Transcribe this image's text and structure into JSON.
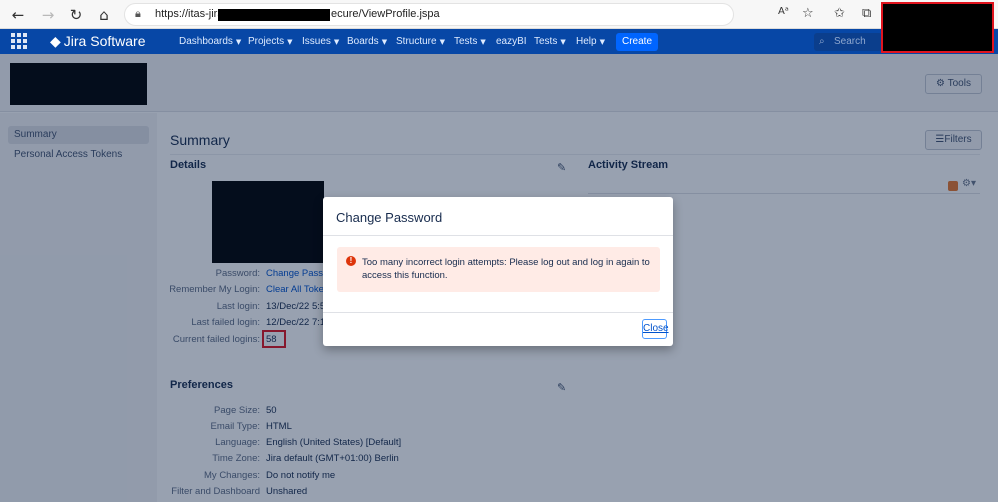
{
  "browser": {
    "url_prefix": "https://itas-jira",
    "url_suffix": "ecure/ViewProfile.jspa",
    "back_icon": "arrow-left-icon",
    "forward_icon": "arrow-right-icon",
    "reload_icon": "reload-icon",
    "home_icon": "home-icon"
  },
  "nav": {
    "product": "Jira Software",
    "menu": [
      {
        "label": "Dashboards",
        "caret": true
      },
      {
        "label": "Projects",
        "caret": true
      },
      {
        "label": "Issues",
        "caret": true
      },
      {
        "label": "Boards",
        "caret": true
      },
      {
        "label": "Structure",
        "caret": true
      },
      {
        "label": "Tests",
        "caret": true
      },
      {
        "label": "eazyBI",
        "caret": false
      },
      {
        "label": "Tests",
        "caret": true
      },
      {
        "label": "Help",
        "caret": true
      }
    ],
    "create_label": "Create",
    "search_placeholder": "Search"
  },
  "header": {
    "tools_label": "Tools"
  },
  "sidebar": {
    "items": [
      {
        "label": "Summary",
        "active": true
      },
      {
        "label": "Personal Access Tokens",
        "active": false
      }
    ]
  },
  "main": {
    "title": "Summary",
    "filters_label": "Filters",
    "details_heading": "Details",
    "activity_heading": "Activity Stream",
    "details": [
      {
        "label": "Password:",
        "value": "Change Passw",
        "link": true
      },
      {
        "label": "Remember My Login:",
        "value": "Clear All Token",
        "link": true
      },
      {
        "label": "Last login:",
        "value": "13/Dec/22 5:5",
        "link": false
      },
      {
        "label": "Last failed login:",
        "value": "12/Dec/22 7:1",
        "link": false
      },
      {
        "label": "Current failed logins:",
        "value": "58",
        "link": false
      }
    ],
    "preferences_heading": "Preferences",
    "preferences": [
      {
        "label": "Page Size:",
        "value": "50"
      },
      {
        "label": "Email Type:",
        "value": "HTML"
      },
      {
        "label": "Language:",
        "value": "English (United States) [Default]"
      },
      {
        "label": "Time Zone:",
        "value": "Jira default (GMT+01:00) Berlin"
      },
      {
        "label": "My Changes:",
        "value": "Do not notify me"
      },
      {
        "label": "Filter and Dashboard",
        "value": "Unshared"
      }
    ]
  },
  "dialog": {
    "title": "Change Password",
    "error_message": "Too many incorrect login attempts: Please log out and log in again to access this function.",
    "close_label": "Close"
  },
  "colors": {
    "jira_nav": "#0747a6",
    "create_button": "#0065ff",
    "error_bg": "#ffebe6",
    "highlight_red": "#e0141e"
  }
}
